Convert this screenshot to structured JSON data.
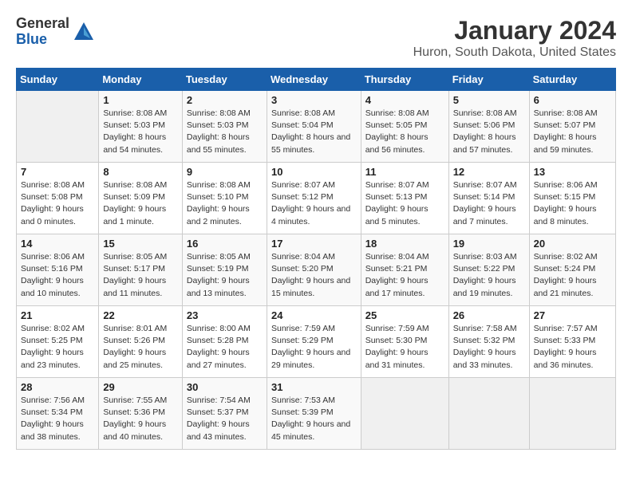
{
  "logo": {
    "general": "General",
    "blue": "Blue"
  },
  "title": "January 2024",
  "subtitle": "Huron, South Dakota, United States",
  "weekdays": [
    "Sunday",
    "Monday",
    "Tuesday",
    "Wednesday",
    "Thursday",
    "Friday",
    "Saturday"
  ],
  "weeks": [
    [
      {
        "num": "",
        "sunrise": "",
        "sunset": "",
        "daylight": ""
      },
      {
        "num": "1",
        "sunrise": "Sunrise: 8:08 AM",
        "sunset": "Sunset: 5:03 PM",
        "daylight": "Daylight: 8 hours and 54 minutes."
      },
      {
        "num": "2",
        "sunrise": "Sunrise: 8:08 AM",
        "sunset": "Sunset: 5:03 PM",
        "daylight": "Daylight: 8 hours and 55 minutes."
      },
      {
        "num": "3",
        "sunrise": "Sunrise: 8:08 AM",
        "sunset": "Sunset: 5:04 PM",
        "daylight": "Daylight: 8 hours and 55 minutes."
      },
      {
        "num": "4",
        "sunrise": "Sunrise: 8:08 AM",
        "sunset": "Sunset: 5:05 PM",
        "daylight": "Daylight: 8 hours and 56 minutes."
      },
      {
        "num": "5",
        "sunrise": "Sunrise: 8:08 AM",
        "sunset": "Sunset: 5:06 PM",
        "daylight": "Daylight: 8 hours and 57 minutes."
      },
      {
        "num": "6",
        "sunrise": "Sunrise: 8:08 AM",
        "sunset": "Sunset: 5:07 PM",
        "daylight": "Daylight: 8 hours and 59 minutes."
      }
    ],
    [
      {
        "num": "7",
        "sunrise": "Sunrise: 8:08 AM",
        "sunset": "Sunset: 5:08 PM",
        "daylight": "Daylight: 9 hours and 0 minutes."
      },
      {
        "num": "8",
        "sunrise": "Sunrise: 8:08 AM",
        "sunset": "Sunset: 5:09 PM",
        "daylight": "Daylight: 9 hours and 1 minute."
      },
      {
        "num": "9",
        "sunrise": "Sunrise: 8:08 AM",
        "sunset": "Sunset: 5:10 PM",
        "daylight": "Daylight: 9 hours and 2 minutes."
      },
      {
        "num": "10",
        "sunrise": "Sunrise: 8:07 AM",
        "sunset": "Sunset: 5:12 PM",
        "daylight": "Daylight: 9 hours and 4 minutes."
      },
      {
        "num": "11",
        "sunrise": "Sunrise: 8:07 AM",
        "sunset": "Sunset: 5:13 PM",
        "daylight": "Daylight: 9 hours and 5 minutes."
      },
      {
        "num": "12",
        "sunrise": "Sunrise: 8:07 AM",
        "sunset": "Sunset: 5:14 PM",
        "daylight": "Daylight: 9 hours and 7 minutes."
      },
      {
        "num": "13",
        "sunrise": "Sunrise: 8:06 AM",
        "sunset": "Sunset: 5:15 PM",
        "daylight": "Daylight: 9 hours and 8 minutes."
      }
    ],
    [
      {
        "num": "14",
        "sunrise": "Sunrise: 8:06 AM",
        "sunset": "Sunset: 5:16 PM",
        "daylight": "Daylight: 9 hours and 10 minutes."
      },
      {
        "num": "15",
        "sunrise": "Sunrise: 8:05 AM",
        "sunset": "Sunset: 5:17 PM",
        "daylight": "Daylight: 9 hours and 11 minutes."
      },
      {
        "num": "16",
        "sunrise": "Sunrise: 8:05 AM",
        "sunset": "Sunset: 5:19 PM",
        "daylight": "Daylight: 9 hours and 13 minutes."
      },
      {
        "num": "17",
        "sunrise": "Sunrise: 8:04 AM",
        "sunset": "Sunset: 5:20 PM",
        "daylight": "Daylight: 9 hours and 15 minutes."
      },
      {
        "num": "18",
        "sunrise": "Sunrise: 8:04 AM",
        "sunset": "Sunset: 5:21 PM",
        "daylight": "Daylight: 9 hours and 17 minutes."
      },
      {
        "num": "19",
        "sunrise": "Sunrise: 8:03 AM",
        "sunset": "Sunset: 5:22 PM",
        "daylight": "Daylight: 9 hours and 19 minutes."
      },
      {
        "num": "20",
        "sunrise": "Sunrise: 8:02 AM",
        "sunset": "Sunset: 5:24 PM",
        "daylight": "Daylight: 9 hours and 21 minutes."
      }
    ],
    [
      {
        "num": "21",
        "sunrise": "Sunrise: 8:02 AM",
        "sunset": "Sunset: 5:25 PM",
        "daylight": "Daylight: 9 hours and 23 minutes."
      },
      {
        "num": "22",
        "sunrise": "Sunrise: 8:01 AM",
        "sunset": "Sunset: 5:26 PM",
        "daylight": "Daylight: 9 hours and 25 minutes."
      },
      {
        "num": "23",
        "sunrise": "Sunrise: 8:00 AM",
        "sunset": "Sunset: 5:28 PM",
        "daylight": "Daylight: 9 hours and 27 minutes."
      },
      {
        "num": "24",
        "sunrise": "Sunrise: 7:59 AM",
        "sunset": "Sunset: 5:29 PM",
        "daylight": "Daylight: 9 hours and 29 minutes."
      },
      {
        "num": "25",
        "sunrise": "Sunrise: 7:59 AM",
        "sunset": "Sunset: 5:30 PM",
        "daylight": "Daylight: 9 hours and 31 minutes."
      },
      {
        "num": "26",
        "sunrise": "Sunrise: 7:58 AM",
        "sunset": "Sunset: 5:32 PM",
        "daylight": "Daylight: 9 hours and 33 minutes."
      },
      {
        "num": "27",
        "sunrise": "Sunrise: 7:57 AM",
        "sunset": "Sunset: 5:33 PM",
        "daylight": "Daylight: 9 hours and 36 minutes."
      }
    ],
    [
      {
        "num": "28",
        "sunrise": "Sunrise: 7:56 AM",
        "sunset": "Sunset: 5:34 PM",
        "daylight": "Daylight: 9 hours and 38 minutes."
      },
      {
        "num": "29",
        "sunrise": "Sunrise: 7:55 AM",
        "sunset": "Sunset: 5:36 PM",
        "daylight": "Daylight: 9 hours and 40 minutes."
      },
      {
        "num": "30",
        "sunrise": "Sunrise: 7:54 AM",
        "sunset": "Sunset: 5:37 PM",
        "daylight": "Daylight: 9 hours and 43 minutes."
      },
      {
        "num": "31",
        "sunrise": "Sunrise: 7:53 AM",
        "sunset": "Sunset: 5:39 PM",
        "daylight": "Daylight: 9 hours and 45 minutes."
      },
      {
        "num": "",
        "sunrise": "",
        "sunset": "",
        "daylight": ""
      },
      {
        "num": "",
        "sunrise": "",
        "sunset": "",
        "daylight": ""
      },
      {
        "num": "",
        "sunrise": "",
        "sunset": "",
        "daylight": ""
      }
    ]
  ]
}
